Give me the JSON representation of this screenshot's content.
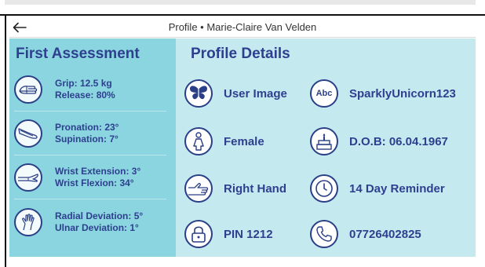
{
  "header": {
    "title": "Profile • Marie-Claire Van Velden",
    "back_icon": "arrow-left-icon"
  },
  "first_assessment": {
    "title": "First Assessment",
    "rows": [
      {
        "icon": "grip-hand-icon",
        "line1": "Grip: 12.5 kg",
        "line2": "Release: 80%"
      },
      {
        "icon": "forearm-rotation-icon",
        "line1": "Pronation: 23°",
        "line2": "Supination: 7°"
      },
      {
        "icon": "wrist-extension-icon",
        "line1": "Wrist Extension: 3°",
        "line2": "Wrist Flexion: 34°"
      },
      {
        "icon": "wrist-deviation-icon",
        "line1": "Radial Deviation: 5°",
        "line2": "Ulnar Deviation: 1°"
      }
    ]
  },
  "profile_details": {
    "title": "Profile Details",
    "user_image": {
      "label": "User Image",
      "icon": "butterfly-icon"
    },
    "username": {
      "label": "SparklyUnicorn123",
      "icon": "abc-icon"
    },
    "gender": {
      "label": "Female",
      "icon": "person-female-icon"
    },
    "dob": {
      "label": "D.O.B: 06.04.1967",
      "icon": "birthday-cake-icon"
    },
    "hand": {
      "label": "Right Hand",
      "icon": "hand-icon"
    },
    "reminder": {
      "label": "14 Day Reminder",
      "icon": "clock-icon"
    },
    "pin": {
      "label": "PIN 1212",
      "icon": "lock-icon"
    },
    "phone": {
      "label": "07726402825",
      "icon": "phone-icon"
    }
  },
  "colors": {
    "accent": "#2f3f8f",
    "left_panel": "#8ad5df",
    "right_panel": "#c4eaf0"
  }
}
